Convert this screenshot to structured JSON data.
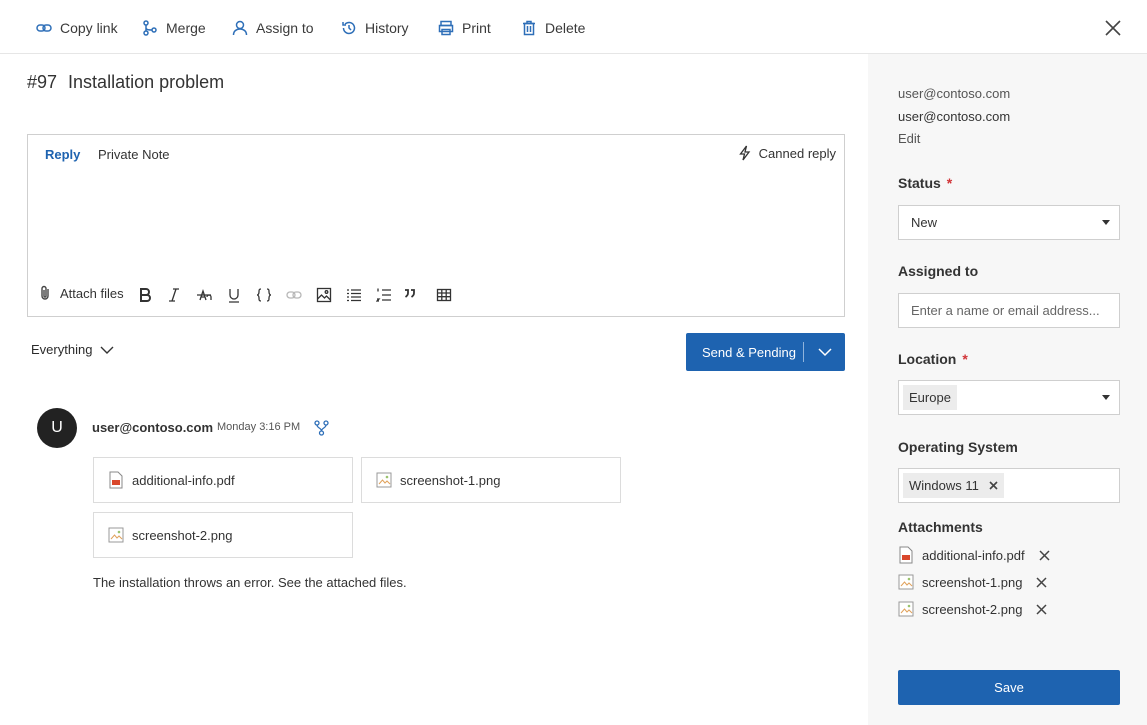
{
  "toolbar": {
    "copy_link": "Copy link",
    "merge": "Merge",
    "assign_to": "Assign to",
    "history": "History",
    "print": "Print",
    "delete": "Delete"
  },
  "ticket": {
    "number": "#97",
    "title": "Installation problem"
  },
  "editor": {
    "tab_reply": "Reply",
    "tab_private_note": "Private Note",
    "canned_reply": "Canned reply",
    "attach_files": "Attach files"
  },
  "filter": {
    "label": "Everything"
  },
  "send": {
    "label": "Send & Pending"
  },
  "message": {
    "avatar_initial": "U",
    "author": "user@contoso.com",
    "time": "Monday 3:16 PM",
    "attachments": [
      "additional-info.pdf",
      "screenshot-1.png",
      "screenshot-2.png"
    ],
    "body": "The installation throws an error. See the attached files."
  },
  "sidebar": {
    "requester_email": "user@contoso.com",
    "requester_name": "user@contoso.com",
    "edit": "Edit",
    "status_label": "Status",
    "status_value": "New",
    "assigned_label": "Assigned to",
    "assigned_placeholder": "Enter a name or email address...",
    "location_label": "Location",
    "location_value": "Europe",
    "os_label": "Operating System",
    "os_value": "Windows 11",
    "attachments_label": "Attachments",
    "attachments": [
      "additional-info.pdf",
      "screenshot-1.png",
      "screenshot-2.png"
    ],
    "save": "Save"
  },
  "colors": {
    "accent": "#1e63b0",
    "required": "#d13438"
  }
}
